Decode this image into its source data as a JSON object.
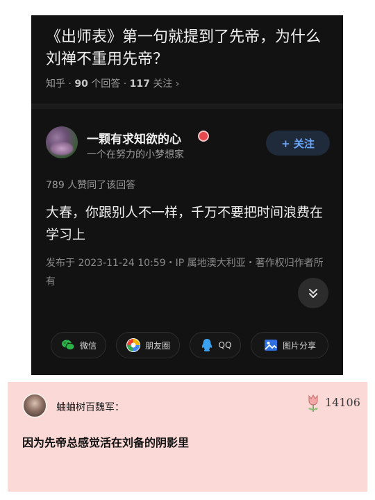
{
  "question": {
    "title": "《出师表》第一句就提到了先帝，为什么刘禅不重用先帝？",
    "source": "知乎",
    "answer_count": "90",
    "answer_suffix": " 个回答 · ",
    "follow_count": "117",
    "follow_suffix": " 关注 ›"
  },
  "author": {
    "name": "一颗有求知欲的心",
    "bio": "一个在努力的小梦想家",
    "follow_label": "+ 关注"
  },
  "answer": {
    "upvotes": "789 人赞同了该回答",
    "text": "大春，你跟别人不一样，千万不要把时间浪费在学习上",
    "publish_info": "发布于 2023-11-24 10:59・IP 属地澳大利亚・著作权归作者所有"
  },
  "share": {
    "wechat": "微信",
    "moments": "朋友圈",
    "qq": "QQ",
    "image": "图片分享"
  },
  "comment": {
    "user": "蛐蛐树百魏军：",
    "likes": "14106",
    "text": "因为先帝总感觉活在刘备的阴影里"
  },
  "colors": {
    "panel_bg": "#121212",
    "accent_blue": "#6aa8ff",
    "comment_bg": "#fbd9d6",
    "badge_red": "#e5484d"
  },
  "icons": [
    "wechat-icon",
    "moments-icon",
    "qq-icon",
    "image-share-icon",
    "double-chevron-down-icon",
    "tulip-icon"
  ]
}
